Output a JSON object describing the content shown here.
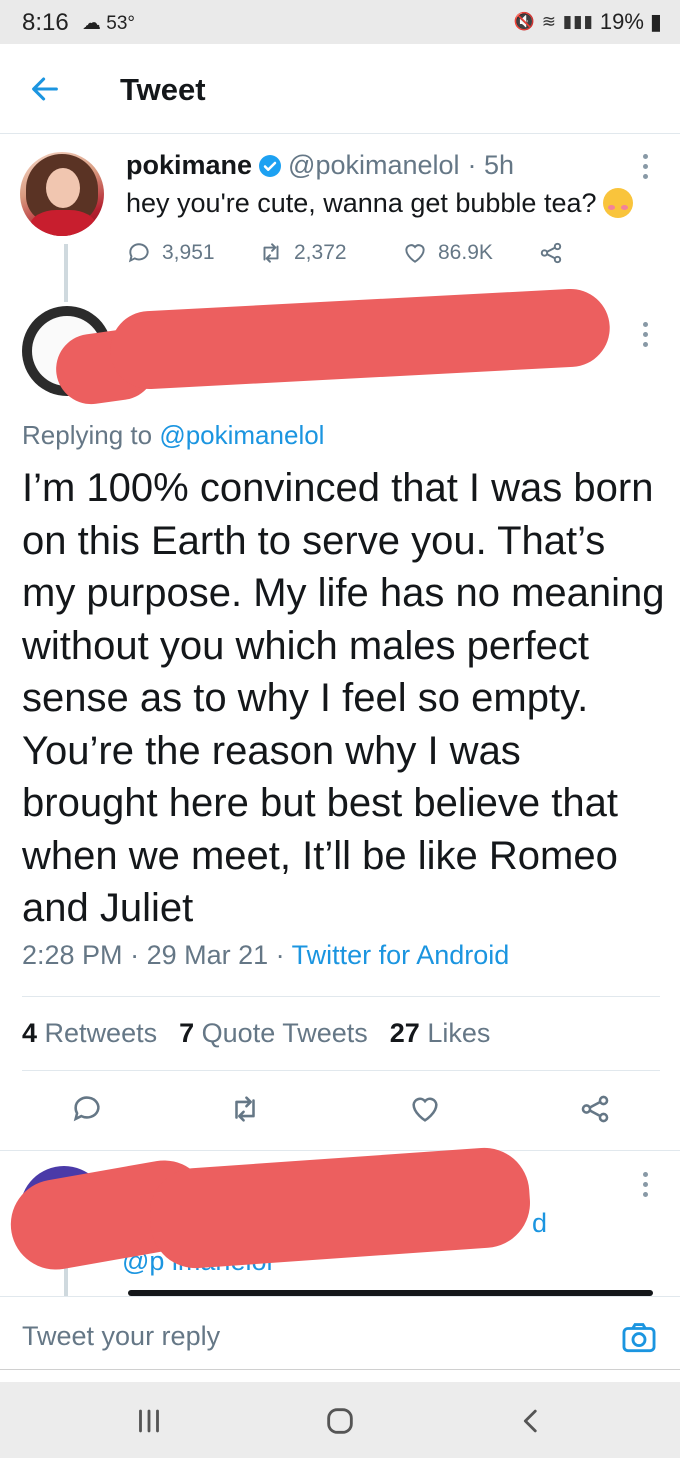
{
  "status_bar": {
    "time": "8:16",
    "temperature": "53°",
    "battery": "19%",
    "icons": [
      "mute-icon",
      "wifi-icon",
      "volte-icon",
      "signal-icon",
      "battery-icon"
    ]
  },
  "header": {
    "title": "Tweet"
  },
  "original_tweet": {
    "name": "pokimane",
    "handle": "@pokimanelol",
    "time": "· 5h",
    "text": "hey you're cute, wanna get bubble tea?",
    "replies": "3,951",
    "retweets": "2,372",
    "likes": "86.9K"
  },
  "reply_tweet": {
    "replying_to_prefix": "Replying to ",
    "replying_to_handle": "@pokimanelol",
    "text": "I’m 100% convinced that I was born on this Earth to serve you. That’s my purpose. My life has no meaning without you which males perfect sense as to why I feel so empty. You’re the reason why I was brought here but best believe that when we meet, It’ll be like Romeo and Juliet",
    "time": "2:28 PM",
    "date": "29 Mar 21",
    "source": "Twitter for Android",
    "retweets_count": "4",
    "retweets_label": "Retweets",
    "quote_count": "7",
    "quote_label": "Quote Tweets",
    "likes_count": "27",
    "likes_label": "Likes"
  },
  "third_tweet": {
    "visible_fragments": {
      "handle_partial": "@p  imaneiol",
      "name_end": "d"
    }
  },
  "composer": {
    "placeholder": "Tweet your reply"
  },
  "colors": {
    "accent": "#1b95e0",
    "text_primary": "#14171a",
    "text_secondary": "#657786",
    "redaction": "#ec5f5f",
    "verified": "#1da1f2"
  }
}
